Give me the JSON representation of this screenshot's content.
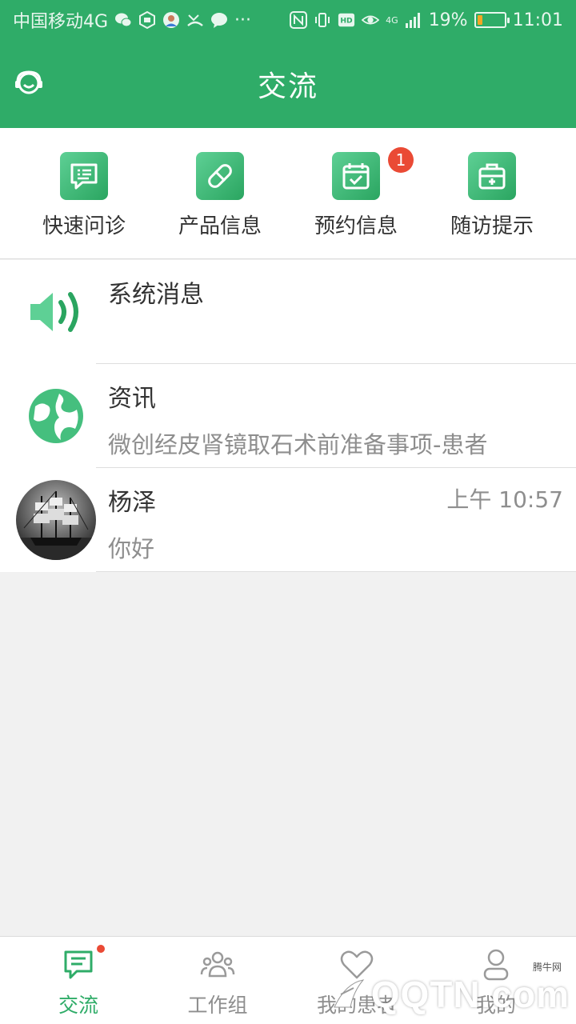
{
  "status_bar": {
    "carrier": "中国移动4G",
    "more": "···",
    "signal": "4G",
    "battery_text": "19%",
    "battery_level": 0.19,
    "time": "11:01"
  },
  "app_bar": {
    "title": "交流"
  },
  "quick_actions": [
    {
      "label": "快速问诊",
      "icon": "chat-consult-icon"
    },
    {
      "label": "产品信息",
      "icon": "pill-icon"
    },
    {
      "label": "预约信息",
      "icon": "calendar-check-icon",
      "badge": "1"
    },
    {
      "label": "随访提示",
      "icon": "medical-kit-icon"
    }
  ],
  "conversations": [
    {
      "name": "系统消息",
      "preview": "",
      "time": "",
      "icon": "speaker-icon"
    },
    {
      "name": "资讯",
      "preview": "微创经皮肾镜取石术前准备事项-患者",
      "time": "",
      "icon": "globe-icon"
    },
    {
      "name": "杨泽",
      "preview": "你好",
      "time": "上午 10:57",
      "icon": "avatar"
    }
  ],
  "tab_bar": [
    {
      "label": "交流",
      "icon": "chat-tab-icon",
      "active": true
    },
    {
      "label": "工作组",
      "icon": "group-icon",
      "active": false
    },
    {
      "label": "我的患者",
      "icon": "heart-icon",
      "active": false
    },
    {
      "label": "我的",
      "icon": "person-icon",
      "active": false
    }
  ],
  "watermark": {
    "text": "QQTN.com",
    "small": "腾牛网"
  },
  "colors": {
    "brand_green": "#2fac68",
    "badge_red": "#ea4a35"
  }
}
